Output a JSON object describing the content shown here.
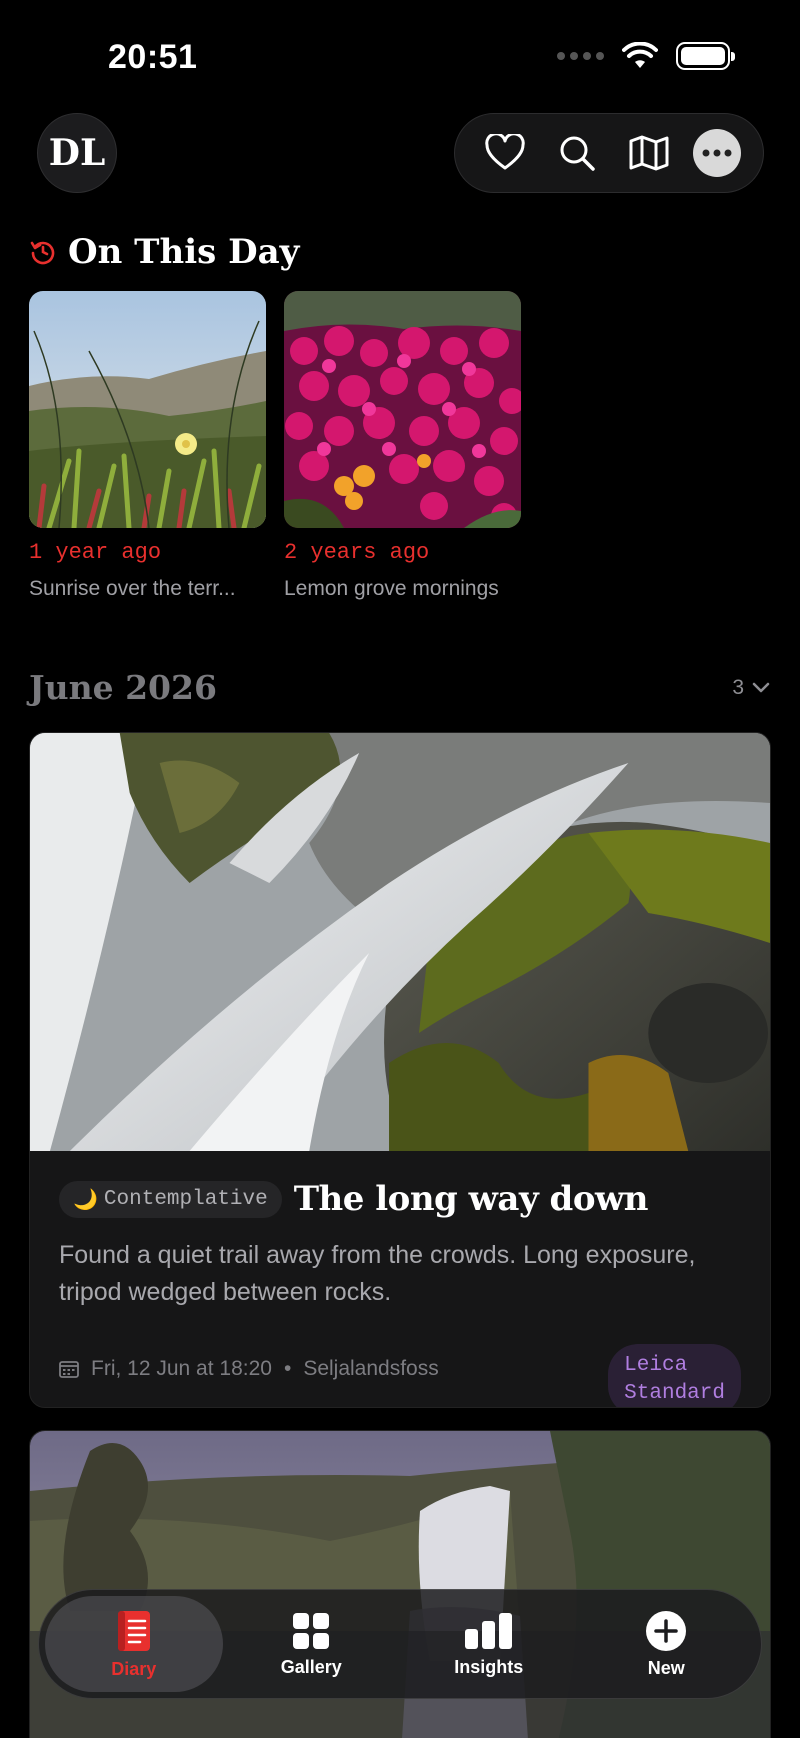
{
  "status_bar": {
    "time": "20:51"
  },
  "header": {
    "avatar_initials": "DL",
    "actions": [
      "heart-icon",
      "search-icon",
      "map-icon",
      "more-icon"
    ]
  },
  "on_this_day": {
    "title": "On This Day",
    "items": [
      {
        "ago": "1 year ago",
        "caption": "Sunrise over the terr..."
      },
      {
        "ago": "2 years ago",
        "caption": "Lemon grove mornings"
      }
    ]
  },
  "month": {
    "label": "June 2026",
    "count": "3"
  },
  "entry": {
    "mood_emoji": "🌙",
    "mood": "Contemplative",
    "title": "The long way down",
    "text": "Found a quiet trail away from the crowds. Long exposure, tripod wedged between rocks.",
    "date": "Fri, 12 Jun at 18:20",
    "separator": "•",
    "location": "Seljalandsfoss",
    "camera_line1": "Leica",
    "camera_line2": "Standard"
  },
  "tabbar": {
    "tabs": [
      {
        "label": "Diary",
        "icon": "diary-icon",
        "active": true
      },
      {
        "label": "Gallery",
        "icon": "gallery-icon",
        "active": false
      },
      {
        "label": "Insights",
        "icon": "insights-icon",
        "active": false
      },
      {
        "label": "New",
        "icon": "plus-icon",
        "active": false
      }
    ]
  },
  "colors": {
    "accent": "#e8302e",
    "camera_chip": "#b07ee0",
    "background": "#000000"
  }
}
